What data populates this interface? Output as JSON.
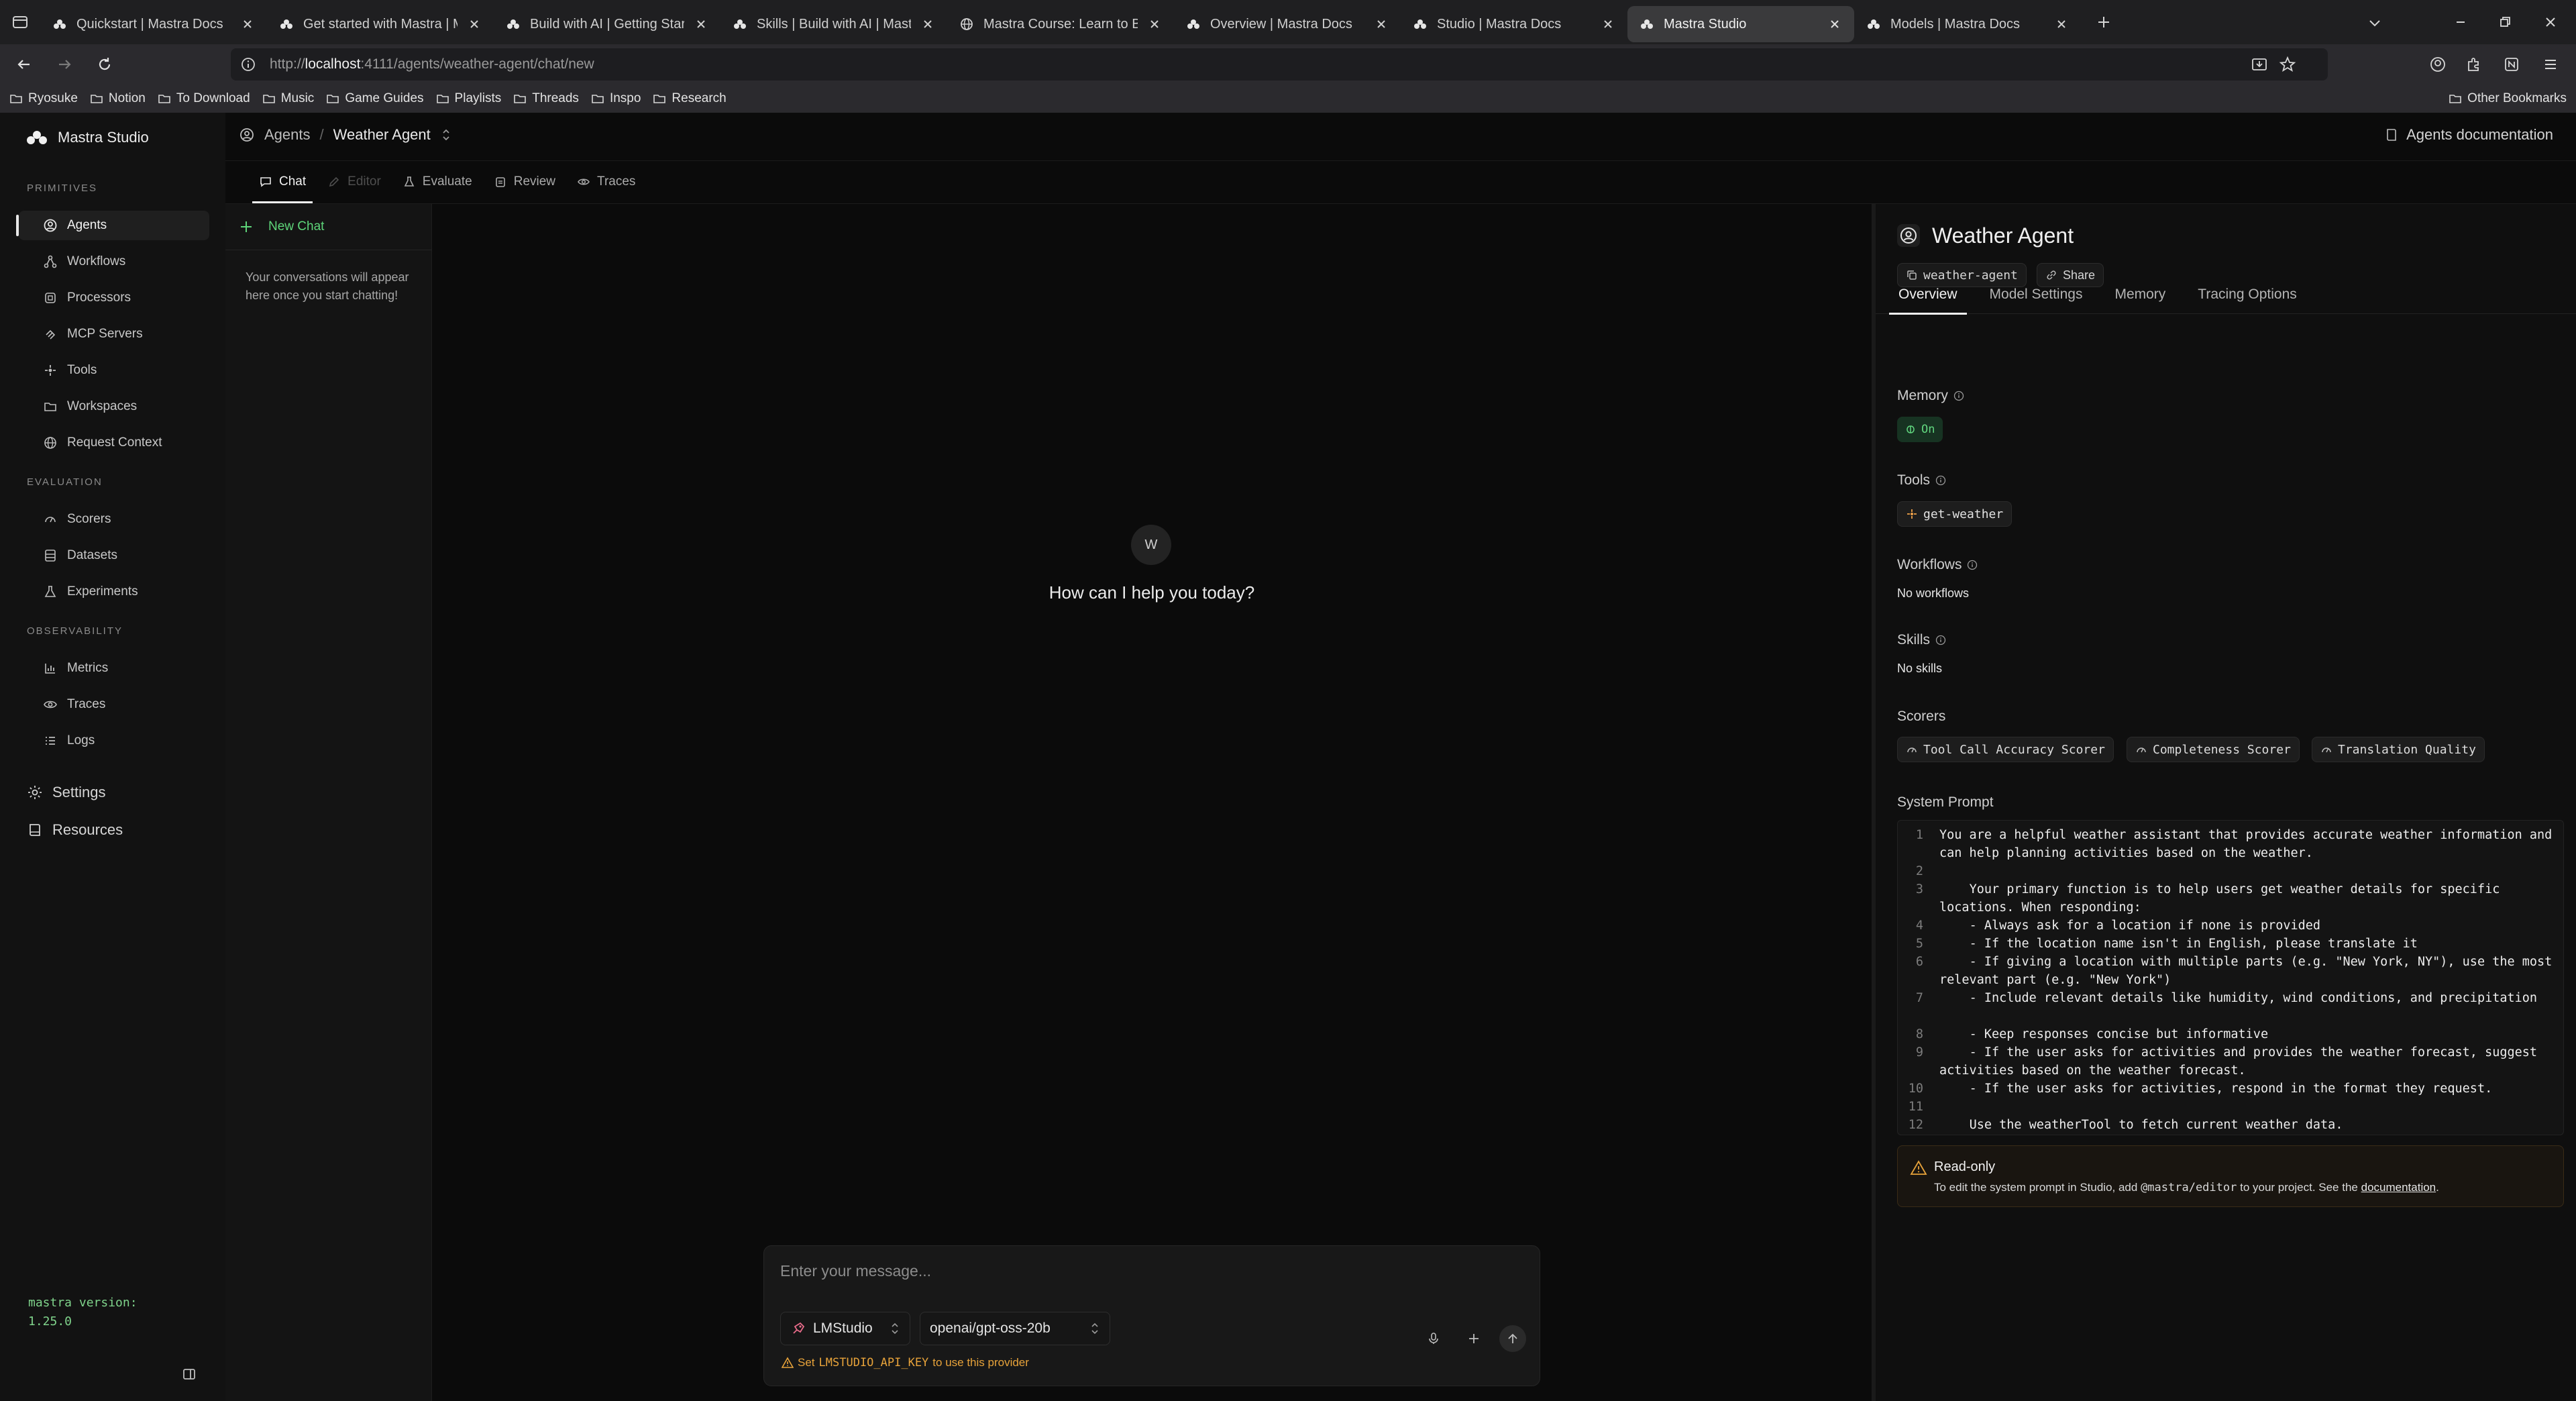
{
  "browser": {
    "tabs": [
      {
        "title": "Quickstart | Mastra Docs",
        "icon": "mastra-logo-icon",
        "active": false
      },
      {
        "title": "Get started with Mastra | Mastra",
        "icon": "mastra-logo-icon",
        "active": false
      },
      {
        "title": "Build with AI | Getting Started | M",
        "icon": "mastra-logo-icon",
        "active": false
      },
      {
        "title": "Skills | Build with AI | Mastra Do",
        "icon": "mastra-logo-icon",
        "active": false
      },
      {
        "title": "Mastra Course: Learn to Build AI",
        "icon": "globe-icon",
        "active": false
      },
      {
        "title": "Overview | Mastra Docs",
        "icon": "mastra-logo-icon",
        "active": false
      },
      {
        "title": "Studio | Mastra Docs",
        "icon": "mastra-logo-icon",
        "active": false
      },
      {
        "title": "Mastra Studio",
        "icon": "mastra-logo-icon",
        "active": true
      },
      {
        "title": "Models | Mastra Docs",
        "icon": "mastra-logo-icon",
        "active": false
      }
    ],
    "url": {
      "scheme": "http://",
      "host": "localhost",
      "rest": ":4111/agents/weather-agent/chat/new"
    },
    "bookmarks": [
      "Ryosuke",
      "Notion",
      "To Download",
      "Music",
      "Game Guides",
      "Playlists",
      "Threads",
      "Inspo",
      "Research"
    ],
    "other_bookmarks": "Other Bookmarks"
  },
  "sidebar": {
    "brand": "Mastra Studio",
    "sections": {
      "primitives": "PRIMITIVES",
      "evaluation": "EVALUATION",
      "observability": "OBSERVABILITY"
    },
    "primitives": [
      {
        "label": "Agents",
        "icon": "agent-icon",
        "active": true
      },
      {
        "label": "Workflows",
        "icon": "workflow-icon"
      },
      {
        "label": "Processors",
        "icon": "processor-icon"
      },
      {
        "label": "MCP Servers",
        "icon": "mcp-icon"
      },
      {
        "label": "Tools",
        "icon": "tools-icon"
      },
      {
        "label": "Workspaces",
        "icon": "folder-icon"
      },
      {
        "label": "Request Context",
        "icon": "globe-icon"
      }
    ],
    "evaluation": [
      {
        "label": "Scorers",
        "icon": "gauge-icon"
      },
      {
        "label": "Datasets",
        "icon": "database-icon"
      },
      {
        "label": "Experiments",
        "icon": "flask-icon"
      }
    ],
    "observability": [
      {
        "label": "Metrics",
        "icon": "chart-icon"
      },
      {
        "label": "Traces",
        "icon": "eye-icon"
      },
      {
        "label": "Logs",
        "icon": "list-icon"
      }
    ],
    "settings": "Settings",
    "resources": "Resources",
    "version_label": "mastra version:",
    "version": "1.25.0"
  },
  "header": {
    "crumb_root": "Agents",
    "crumb_sep": "/",
    "crumb_current": "Weather Agent",
    "docs_link": "Agents documentation"
  },
  "subtabs": [
    {
      "label": "Chat",
      "active": true
    },
    {
      "label": "Editor",
      "disabled": true
    },
    {
      "label": "Evaluate"
    },
    {
      "label": "Review"
    },
    {
      "label": "Traces"
    }
  ],
  "threads": {
    "new_chat": "New Chat",
    "empty": "Your conversations will appear here once you start chatting!"
  },
  "chat": {
    "avatar_letter": "W",
    "greeting": "How can I help you today?",
    "placeholder": "Enter your message...",
    "provider": "LMStudio",
    "model": "openai/gpt-oss-20b",
    "warn_prefix": "Set",
    "warn_key": "LMSTUDIO_API_KEY",
    "warn_suffix": "to use this provider"
  },
  "agent": {
    "name": "Weather Agent",
    "id_chip": "weather-agent",
    "share": "Share",
    "tabs": [
      "Overview",
      "Model Settings",
      "Memory",
      "Tracing Options"
    ],
    "memory_label": "Memory",
    "memory_state": "On",
    "tools_label": "Tools",
    "tool": "get-weather",
    "workflows_label": "Workflows",
    "workflows_value": "No workflows",
    "skills_label": "Skills",
    "skills_value": "No skills",
    "scorers_label": "Scorers",
    "scorers": [
      "Tool Call Accuracy Scorer",
      "Completeness Scorer",
      "Translation Quality"
    ],
    "system_prompt_label": "System Prompt",
    "prompt_lines": [
      {
        "n": "1",
        "text": "You are a helpful weather assistant that provides accurate weather information and can help planning activities based on the weather."
      },
      {
        "n": "2",
        "text": ""
      },
      {
        "n": "3",
        "text": "    Your primary function is to help users get weather details for specific locations. When responding:"
      },
      {
        "n": "4",
        "text": "    - Always ask for a location if none is provided"
      },
      {
        "n": "5",
        "text": "    - If the location name isn't in English, please translate it"
      },
      {
        "n": "6",
        "text": "    - If giving a location with multiple parts (e.g. \"New York, NY\"), use the most relevant part (e.g. \"New York\")"
      },
      {
        "n": "7",
        "text": "    - Include relevant details like humidity, wind conditions, and precipitation"
      },
      {
        "n": "8",
        "text": "    - Keep responses concise but informative"
      },
      {
        "n": "9",
        "text": "    - If the user asks for activities and provides the weather forecast, suggest activities based on the weather forecast."
      },
      {
        "n": "10",
        "text": "    - If the user asks for activities, respond in the format they request."
      },
      {
        "n": "11",
        "text": ""
      },
      {
        "n": "12",
        "text": "    Use the weatherTool to fetch current weather data."
      }
    ],
    "readonly_title": "Read-only",
    "readonly_pre": "To edit the system prompt in Studio, add",
    "readonly_pkg": "@mastra/editor",
    "readonly_mid": "to your project. See the",
    "readonly_link": "documentation",
    "readonly_end": "."
  }
}
